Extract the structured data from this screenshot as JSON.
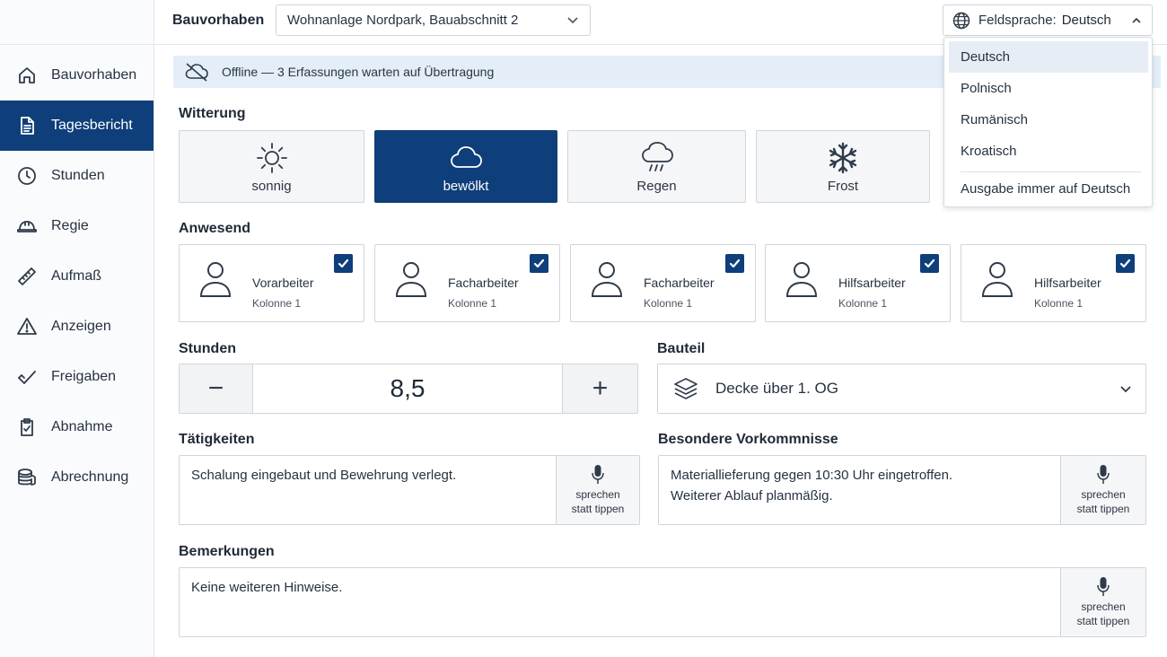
{
  "topbar": {
    "project_label": "Bauvorhaben",
    "project_value": "Wohnanlage Nordpark, Bauabschnitt 2",
    "lang_label": "Feldsprache:",
    "lang_value": "Deutsch"
  },
  "sidebar": {
    "items": [
      {
        "label": "Bauvorhaben",
        "icon": "home-icon"
      },
      {
        "label": "Tagesbericht",
        "icon": "document-icon",
        "active": true
      },
      {
        "label": "Stunden",
        "icon": "clock-icon"
      },
      {
        "label": "Regie",
        "icon": "hardhat-icon"
      },
      {
        "label": "Aufmaß",
        "icon": "ruler-icon"
      },
      {
        "label": "Anzeigen",
        "icon": "warning-icon"
      },
      {
        "label": "Freigaben",
        "icon": "check-icon"
      },
      {
        "label": "Abnahme",
        "icon": "clipboard-icon"
      },
      {
        "label": "Abrechnung",
        "icon": "coins-icon"
      }
    ]
  },
  "banner": {
    "text": "Offline — 3 Erfassungen warten auf Übertragung",
    "icon": "cloud-offline-icon"
  },
  "weather": {
    "title": "Witterung",
    "options": [
      {
        "label": "sonnig",
        "icon": "sun-icon"
      },
      {
        "label": "bewölkt",
        "icon": "cloud-icon",
        "selected": true
      },
      {
        "label": "Regen",
        "icon": "rain-icon"
      },
      {
        "label": "Frost",
        "icon": "snowflake-icon"
      }
    ]
  },
  "presence": {
    "title": "Anwesend",
    "people": [
      {
        "role": "Vorarbeiter",
        "crew": "Kolonne 1",
        "checked": true
      },
      {
        "role": "Facharbeiter",
        "crew": "Kolonne 1",
        "checked": true
      },
      {
        "role": "Facharbeiter",
        "crew": "Kolonne 1",
        "checked": true
      },
      {
        "role": "Hilfsarbeiter",
        "crew": "Kolonne 1",
        "checked": true
      },
      {
        "role": "Hilfsarbeiter",
        "crew": "Kolonne 1",
        "checked": true
      }
    ]
  },
  "hours": {
    "title": "Stunden",
    "value": "8,5",
    "minus": "−",
    "plus": "+"
  },
  "bauteil": {
    "title": "Bauteil",
    "value": "Decke über 1. OG",
    "icon": "layers-icon"
  },
  "activities": {
    "title": "Tätigkeiten",
    "text": "Schalung eingebaut und Bewehrung verlegt.",
    "mic_label": "sprechen\nstatt tippen"
  },
  "incidents": {
    "title": "Besondere Vorkommnisse",
    "text": "Materiallieferung gegen 10:30 Uhr eingetroffen.\nWeiterer Ablauf planmäßig.",
    "mic_label": "sprechen\nstatt tippen"
  },
  "remarks": {
    "title": "Bemerkungen",
    "text": "Keine weiteren Hinweise.",
    "mic_label": "sprechen\nstatt tippen"
  },
  "language_dropdown": {
    "options": [
      "Deutsch",
      "Polnisch",
      "Rumänisch",
      "Kroatisch"
    ],
    "selected": "Deutsch",
    "footer": "Ausgabe immer auf Deutsch"
  },
  "colors": {
    "primary": "#0f3f7a",
    "banner_bg": "#e3eef9",
    "border": "#cfd5dc"
  }
}
